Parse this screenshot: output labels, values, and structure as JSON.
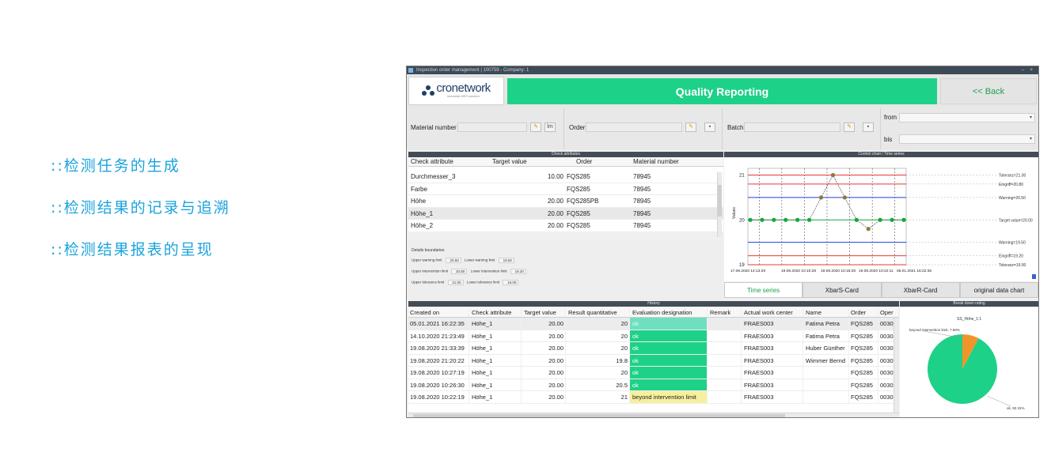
{
  "bullets": [
    "::检测任务的生成",
    "::检测结果的记录与追溯",
    "::检测结果报表的呈现"
  ],
  "window": {
    "title": "Inspection order management | 100759 - Company: 1",
    "controls": "– ×"
  },
  "header": {
    "logo_text": "cronetwork",
    "logo_tagline": "industrial MES solution",
    "banner": "Quality Reporting",
    "back_label": "<< Back"
  },
  "filters": {
    "material_label": "Material number",
    "order_label": "Order",
    "batch_label": "Batch",
    "from_label": "from",
    "to_label": "bis",
    "lm_button": "lm",
    "save_glyph": "▪",
    "pencil_glyph": "✎",
    "dropdown_glyph": "▾"
  },
  "check_attributes": {
    "title": "Check attributes",
    "columns": [
      "Check attribute",
      "Target value",
      "Order",
      "Material number"
    ],
    "rows": [
      {
        "attr": "Durchmesser_3",
        "target": "10.00",
        "order": "FQS285",
        "material": "78945"
      },
      {
        "attr": "Farbe",
        "target": "",
        "order": "FQS285",
        "material": "78945"
      },
      {
        "attr": "Höhe",
        "target": "20.00",
        "order": "FQS285PB",
        "material": "78945"
      },
      {
        "attr": "Höhe_1",
        "target": "20.00",
        "order": "FQS285",
        "material": "78945"
      },
      {
        "attr": "Höhe_2",
        "target": "20.00",
        "order": "FQS285",
        "material": "78945"
      }
    ]
  },
  "details": {
    "title": "Details boundaries",
    "upper_warning_label": "Upper warning limit",
    "upper_warning": "20.50",
    "lower_warning_label": "Lower warning limit",
    "lower_warning": "19.50",
    "upper_intervention_label": "Upper intervention limit",
    "upper_intervention": "20.80",
    "lower_intervention_label": "Lower intervention limit",
    "lower_intervention": "19.20",
    "upper_tolerance_label": "Upper tolerance limit",
    "upper_tolerance": "21.00",
    "lower_tolerance_label": "Lower tolerance limit",
    "lower_tolerance": "19.00"
  },
  "control_chart": {
    "title": "Control chart / Time series",
    "right_labels": {
      "tol_upper": "Toleranz=21.00",
      "eingriff_upper": "Eingriff=20.80",
      "warning_upper": "Warning=20.50",
      "target": "Target value=20.00",
      "warning_lower": "Warning=19.50",
      "eingriff_lower": "Eingriff=19.20",
      "tol_lower": "Toleranz=19.00"
    },
    "x_ticks": [
      "17.08.2020 14:13:29",
      "19.08.2020 10:10:28",
      "19.08.2020 10:18:28",
      "19.08.2020 10:22:11",
      "05.01.2021 16:22:35"
    ]
  },
  "chart_data": {
    "type": "line",
    "ylabel": "Values",
    "ylim": [
      19,
      21.15
    ],
    "y_ticks": [
      "21",
      "20",
      "19"
    ],
    "x": [
      "17.08.2020 14:13:29",
      "",
      "",
      "",
      "",
      "19.08.2020 10:10:28",
      "",
      "19.08.2020 10:18:28",
      "",
      "19.08.2020 10:22:11",
      "",
      "",
      "05.01.2021 16:22:35"
    ],
    "series": [
      {
        "values": [
          20,
          20,
          20,
          20,
          20,
          20,
          20.5,
          21,
          20.5,
          20,
          19.8,
          20,
          20,
          20
        ]
      }
    ],
    "limits": {
      "tolerance": [
        19.0,
        21.0
      ],
      "intervention": [
        19.2,
        20.8
      ],
      "warning": [
        19.5,
        20.5
      ],
      "target": 20.0
    },
    "colors": {
      "tolerance": "#e53935",
      "intervention": "#e53935",
      "warning": "#1e40d8",
      "target": "#11a83a",
      "points": "#11a83a",
      "highlight": "#8a7a3a"
    }
  },
  "tabs": [
    "Time series",
    "XbarS-Card",
    "XbarR-Card",
    "original data chart"
  ],
  "history": {
    "title": "History",
    "columns": [
      "Created on",
      "Check attribute",
      "Target value",
      "Result quantitative",
      "Evaluation designation",
      "Remark",
      "Actual work center",
      "Name",
      "Order",
      "Oper"
    ],
    "rows": [
      {
        "date": "05.01.2021 16:22:35",
        "attr": "Höhe_1",
        "target": "20.00",
        "result": "20",
        "eval": "ok",
        "eval_style": "ok-light",
        "remark": "",
        "awc": "FRAES003",
        "name": "Fatima Petra",
        "order": "FQS285",
        "oper": "0030"
      },
      {
        "date": "14.10.2020 21:23:49",
        "attr": "Höhe_1",
        "target": "20.00",
        "result": "20",
        "eval": "ok",
        "eval_style": "ok",
        "remark": "",
        "awc": "FRAES003",
        "name": "Fatima Petra",
        "order": "FQS285",
        "oper": "0030"
      },
      {
        "date": "19.08.2020 21:33:39",
        "attr": "Höhe_1",
        "target": "20.00",
        "result": "20",
        "eval": "ok",
        "eval_style": "ok",
        "remark": "",
        "awc": "FRAES003",
        "name": "Huber Günther",
        "order": "FQS285",
        "oper": "0030"
      },
      {
        "date": "19.08.2020 21:20:22",
        "attr": "Höhe_1",
        "target": "20.00",
        "result": "19.8",
        "eval": "ok",
        "eval_style": "ok",
        "remark": "",
        "awc": "FRAES003",
        "name": "Wimmer Bernd",
        "order": "FQS285",
        "oper": "0030"
      },
      {
        "date": "19.08.2020 10:27:19",
        "attr": "Höhe_1",
        "target": "20.00",
        "result": "20",
        "eval": "ok",
        "eval_style": "ok",
        "remark": "",
        "awc": "FRAES003",
        "name": "",
        "order": "FQS285",
        "oper": "0030"
      },
      {
        "date": "19.08.2020 10:26:30",
        "attr": "Höhe_1",
        "target": "20.00",
        "result": "20.5",
        "eval": "ok",
        "eval_style": "ok",
        "remark": "",
        "awc": "FRAES003",
        "name": "",
        "order": "FQS285",
        "oper": "0030"
      },
      {
        "date": "19.08.2020 10:22:19",
        "attr": "Höhe_1",
        "target": "20.00",
        "result": "21",
        "eval": "beyond intervention limit",
        "eval_style": "warn",
        "remark": "",
        "awc": "FRAES003",
        "name": "",
        "order": "FQS285",
        "oper": "0030"
      }
    ]
  },
  "breakdown": {
    "title": "Break down rating",
    "subtitle": "SS_Höhe_1:1",
    "label_beyond": "beyond intervention limit, 7.69%",
    "label_ok": "ok, 92.31%",
    "slices": [
      {
        "name": "ok",
        "value": 92.31,
        "color": "#1ed188"
      },
      {
        "name": "beyond intervention limit",
        "value": 7.69,
        "color": "#f0952a"
      }
    ]
  }
}
